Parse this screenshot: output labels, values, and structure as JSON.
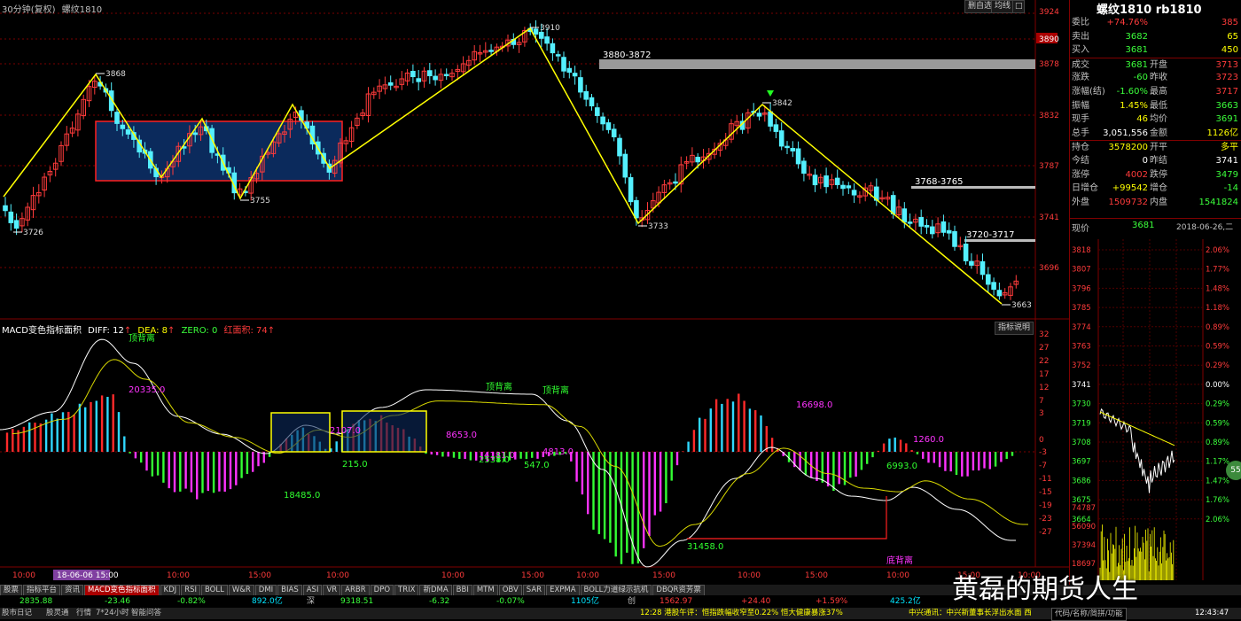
{
  "header": {
    "period": "30分钟(复权)",
    "symbol": "螺纹1810",
    "buttons": [
      "删自选",
      "均线",
      "最大化"
    ]
  },
  "price_axis": [
    "3924",
    "3890",
    "3878",
    "3832",
    "3787",
    "3741",
    "3696"
  ],
  "annotations": {
    "h3910": "3910",
    "h3868": "3868",
    "l3755": "3755",
    "l3726": "3726",
    "range1": "3880-3872",
    "h3842": "3842",
    "l3733": "3733",
    "range2": "3768-3765",
    "range3": "3720-3717",
    "l3663": "3663"
  },
  "macd": {
    "title": "MACD变色指标面积",
    "diff": "DIFF: 12",
    "dea": "DEA: 8",
    "zero": "ZERO: 0",
    "red_area": "红面积: 74",
    "help": "指标说明",
    "axis": [
      "32",
      "27",
      "22",
      "17",
      "12",
      "7",
      "3",
      "0",
      "-3",
      "-7",
      "-11",
      "-15",
      "-19",
      "-23",
      "-27"
    ],
    "labels": {
      "top1": "顶背离",
      "top2": "顶背离",
      "top3": "顶背离",
      "bottom": "底背离",
      "a1": "20335.0",
      "a2": "18485.0",
      "a3": "2107.0",
      "a4": "215.0",
      "a5": "8653.0",
      "a6": "4181.0",
      "a7": "2538.0",
      "a8": "547.0",
      "a9": "4813.0",
      "a10": "31458.0",
      "a11": "16698.0",
      "a12": "1260.0",
      "a13": "6993.0"
    }
  },
  "time_axis": [
    "10:00",
    "18-06-06 15:00",
    "10:00",
    "15:00",
    "10:00",
    "10:00",
    "15:00",
    "10:00",
    "15:00",
    "10:00",
    "15:00",
    "10:00",
    "15:00",
    "10:00"
  ],
  "side": {
    "title": "螺纹1810 rb1810",
    "rows": [
      {
        "l": "委比",
        "v": "+74.76%",
        "r": "",
        "rv": "385",
        "vc": "red",
        "rc": "red"
      },
      {
        "l": "卖出",
        "v": "3682",
        "r": "",
        "rv": "65",
        "vc": "green",
        "rc": "yellow"
      },
      {
        "l": "买入",
        "v": "3681",
        "r": "",
        "rv": "450",
        "vc": "green",
        "rc": "yellow"
      },
      {
        "l": "成交",
        "v": "3681",
        "r": "开盘",
        "rv": "3713",
        "vc": "green",
        "rc": "red"
      },
      {
        "l": "涨跌",
        "v": "-60",
        "r": "昨收",
        "rv": "3723",
        "vc": "green",
        "rc": "red"
      },
      {
        "l": "涨幅(结)",
        "v": "-1.60%",
        "r": "最高",
        "rv": "3717",
        "vc": "green",
        "rc": "red"
      },
      {
        "l": "振幅",
        "v": "1.45%",
        "r": "最低",
        "rv": "3663",
        "vc": "yellow",
        "rc": "green"
      },
      {
        "l": "现手",
        "v": "46",
        "r": "均价",
        "rv": "3691",
        "vc": "yellow",
        "rc": "green"
      },
      {
        "l": "总手",
        "v": "3,051,556",
        "r": "金额",
        "rv": "1126亿",
        "vc": "white",
        "rc": "yellow"
      },
      {
        "l": "持仓",
        "v": "3578200",
        "r": "开平",
        "rv": "多平",
        "vc": "yellow",
        "rc": "yellow"
      },
      {
        "l": "今结",
        "v": "0",
        "r": "昨结",
        "rv": "3741",
        "vc": "white",
        "rc": "white"
      },
      {
        "l": "涨停",
        "v": "4002",
        "r": "跌停",
        "rv": "3479",
        "vc": "red",
        "rc": "green"
      },
      {
        "l": "日增仓",
        "v": "+99542",
        "r": "增仓",
        "rv": "-14",
        "vc": "yellow",
        "rc": "green"
      },
      {
        "l": "外盘",
        "v": "1509732",
        "r": "内盘",
        "rv": "1541824",
        "vc": "red",
        "rc": "green"
      }
    ],
    "now_label": "现价",
    "now_price": "3681",
    "now_date": "2018-06-26,二",
    "mini_left": [
      "3818",
      "3807",
      "3796",
      "3785",
      "3774",
      "3763",
      "3752",
      "3741",
      "3730",
      "3719",
      "3708",
      "3697",
      "3686",
      "3675",
      "3664"
    ],
    "mini_right": [
      "2.06%",
      "1.77%",
      "1.48%",
      "1.18%",
      "0.89%",
      "0.59%",
      "0.29%",
      "0.00%",
      "0.29%",
      "0.59%",
      "0.89%",
      "1.17%",
      "1.47%",
      "1.76%",
      "2.06%"
    ],
    "vol_axis": [
      "74787",
      "56090",
      "37394",
      "18697"
    ],
    "bubble": "55"
  },
  "tabs": [
    "股票",
    "指标平台",
    "资讯",
    "MACD变色指标面积",
    "KDJ",
    "RSI",
    "BOLL",
    "W&R",
    "DMI",
    "BIAS",
    "ASI",
    "VR",
    "ARBR",
    "DPO",
    "TRIX",
    "新DMA",
    "BBI",
    "MTM",
    "OBV",
    "SAR",
    "EXPMA",
    "BOLL力道绿示抗机",
    "DBQR资芳票"
  ],
  "status": {
    "a": "2835.88",
    "b": "-23.46",
    "c": "-0.82%",
    "d": "892.0亿",
    "e": "深",
    "f": "9318.51",
    "g": "-6.32",
    "h": "-0.07%",
    "i": "1105亿",
    "j": "创",
    "k": "1562.97",
    "l": "+24.40",
    "m": "+1.59%",
    "n": "425.2亿"
  },
  "status2": {
    "items": [
      "股市日记",
      "股灵通",
      "行情",
      "7*24小时",
      "智能问答"
    ],
    "news": "12:28 港股午评：恒指跌幅收窄至0.22% 恒大健康暴涨37%",
    "news2": "中兴通讯：中兴新董事长浮出水面 西",
    "search": "代码/名称/简拼/功能",
    "clock": "12:43:47"
  },
  "watermark": "黄磊的期货人生"
}
